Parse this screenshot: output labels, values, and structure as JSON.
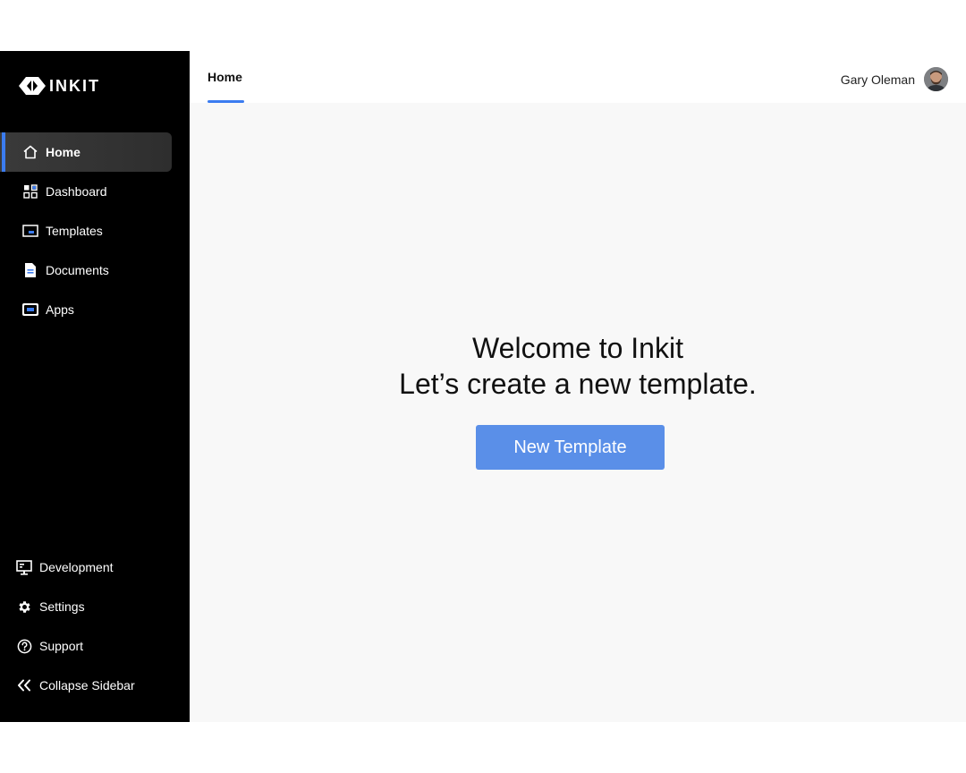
{
  "brand": {
    "name": "INKIT"
  },
  "sidebar": {
    "items": [
      {
        "label": "Home",
        "icon": "home-icon",
        "active": true
      },
      {
        "label": "Dashboard",
        "icon": "dashboard-icon",
        "active": false
      },
      {
        "label": "Templates",
        "icon": "templates-icon",
        "active": false
      },
      {
        "label": "Documents",
        "icon": "documents-icon",
        "active": false
      },
      {
        "label": "Apps",
        "icon": "apps-icon",
        "active": false
      }
    ],
    "bottom_items": [
      {
        "label": "Development",
        "icon": "monitor-icon"
      },
      {
        "label": "Settings",
        "icon": "gear-icon"
      },
      {
        "label": "Support",
        "icon": "question-icon"
      },
      {
        "label": "Collapse Sidebar",
        "icon": "double-chevron-left-icon"
      }
    ]
  },
  "header": {
    "tab_label": "Home",
    "user_name": "Gary Oleman"
  },
  "main": {
    "welcome_line1": "Welcome to Inkit",
    "welcome_line2": "Let’s create a new template.",
    "cta_label": "New Template"
  },
  "colors": {
    "accent": "#3b7cf0",
    "button": "#5a8fe8",
    "sidebar_bg": "#000000",
    "main_bg": "#f8f8f8"
  }
}
